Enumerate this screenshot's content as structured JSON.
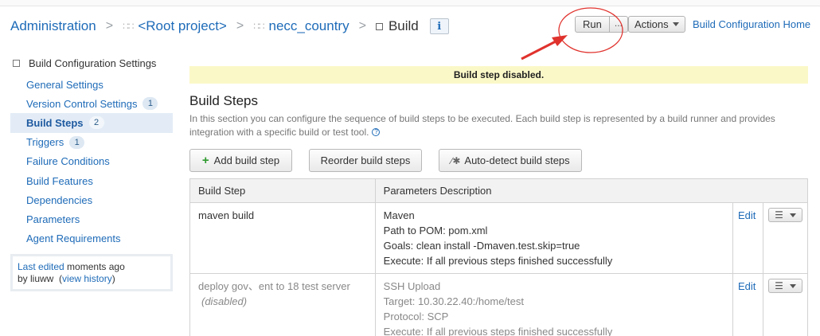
{
  "header": {
    "breadcrumb": {
      "administration": "Administration",
      "root_project": "<Root project>",
      "project": "necc_country",
      "current": "Build"
    },
    "info_label": "i",
    "run_label": "Run",
    "run_more_label": "...",
    "actions_label": "Actions",
    "home_link": "Build Configuration Home"
  },
  "sidebar": {
    "title": "Build Configuration Settings",
    "items": [
      {
        "label": "General Settings",
        "badge": ""
      },
      {
        "label": "Version Control Settings",
        "badge": "1"
      },
      {
        "label": "Build Steps",
        "badge": "2"
      },
      {
        "label": "Triggers",
        "badge": "1"
      },
      {
        "label": "Failure Conditions",
        "badge": ""
      },
      {
        "label": "Build Features",
        "badge": ""
      },
      {
        "label": "Dependencies",
        "badge": ""
      },
      {
        "label": "Parameters",
        "badge": ""
      },
      {
        "label": "Agent Requirements",
        "badge": ""
      }
    ],
    "last_edited": {
      "prefix": "Last edited",
      "when": " moments ago",
      "by": "by liuww",
      "history_link": "view history"
    }
  },
  "main": {
    "banner": "Build step disabled.",
    "title": "Build Steps",
    "description": "In this section you can configure the sequence of build steps to be executed. Each build step is represented by a build runner and provides integration with a specific build or test tool.",
    "buttons": {
      "add": "Add build step",
      "reorder": "Reorder build steps",
      "autodetect": "Auto-detect build steps"
    },
    "table": {
      "headers": [
        "Build Step",
        "Parameters Description"
      ],
      "rows": [
        {
          "name": "maven build",
          "note": "",
          "params": [
            "Maven",
            "Path to POM: pom.xml",
            "Goals: clean install -Dmaven.test.skip=true",
            "Execute: If all previous steps finished successfully"
          ],
          "edit": "Edit"
        },
        {
          "name": "deploy gov、ent to 18 test server",
          "note": "(disabled)",
          "params": [
            "SSH Upload",
            "Target: 10.30.22.40:/home/test",
            "Protocol: SCP",
            "Execute: If all previous steps finished successfully"
          ],
          "edit": "Edit"
        }
      ]
    }
  },
  "colors": {
    "link": "#1e6bb8",
    "banner_bg": "#fbf8c8",
    "active_bg": "#e3ecf6",
    "annotation": "#e0322d"
  }
}
